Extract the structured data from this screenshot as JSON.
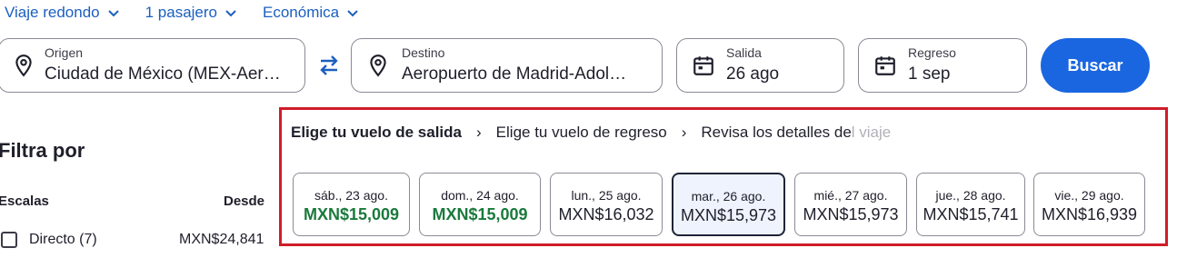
{
  "trip_options": {
    "trip_type": "Viaje redondo",
    "passengers": "1 pasajero",
    "cabin": "Económica"
  },
  "search": {
    "origin_label": "Origen",
    "origin_value": "Ciudad de México (MEX-Aer…",
    "destination_label": "Destino",
    "destination_value": "Aeropuerto de Madrid-Adol…",
    "depart_label": "Salida",
    "depart_value": "26 ago",
    "return_label": "Regreso",
    "return_value": "1 sep",
    "search_button": "Buscar",
    "accent_color": "#1a66e0"
  },
  "filters": {
    "title": "Filtra por",
    "stops_label": "Escalas",
    "from_label": "Desde",
    "direct_option": "Directo (7)",
    "direct_price": "MXN$24,841"
  },
  "breadcrumb": {
    "step1": "Elige tu vuelo de salida",
    "step2": "Elige tu vuelo de regreso",
    "step3_visible": "Revisa los detalles de",
    "step3_faded": "l viaje"
  },
  "date_prices": [
    {
      "date": "sáb., 23 ago.",
      "price": "MXN$15,009",
      "cheapest": true,
      "selected": false
    },
    {
      "date": "dom., 24 ago.",
      "price": "MXN$15,009",
      "cheapest": true,
      "selected": false
    },
    {
      "date": "lun., 25 ago.",
      "price": "MXN$16,032",
      "cheapest": false,
      "selected": false
    },
    {
      "date": "mar., 26 ago.",
      "price": "MXN$15,973",
      "cheapest": false,
      "selected": true
    },
    {
      "date": "mié., 27 ago.",
      "price": "MXN$15,973",
      "cheapest": false,
      "selected": false
    },
    {
      "date": "jue., 28 ago.",
      "price": "MXN$15,741",
      "cheapest": false,
      "selected": false
    },
    {
      "date": "vie., 29 ago.",
      "price": "MXN$16,939",
      "cheapest": false,
      "selected": false
    }
  ],
  "colors": {
    "cheapest_price": "#1a7a3c",
    "highlight_box": "#d01d2a",
    "link_blue": "#1b5fbf"
  }
}
